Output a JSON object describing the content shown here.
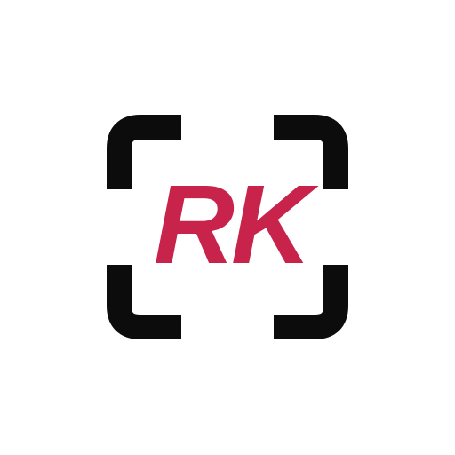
{
  "logo": {
    "text": "RK",
    "icon": "scan-frame-icon",
    "colors": {
      "text": "#c8234a",
      "frame": "#0c0c0c",
      "background": "#ffffff"
    }
  }
}
